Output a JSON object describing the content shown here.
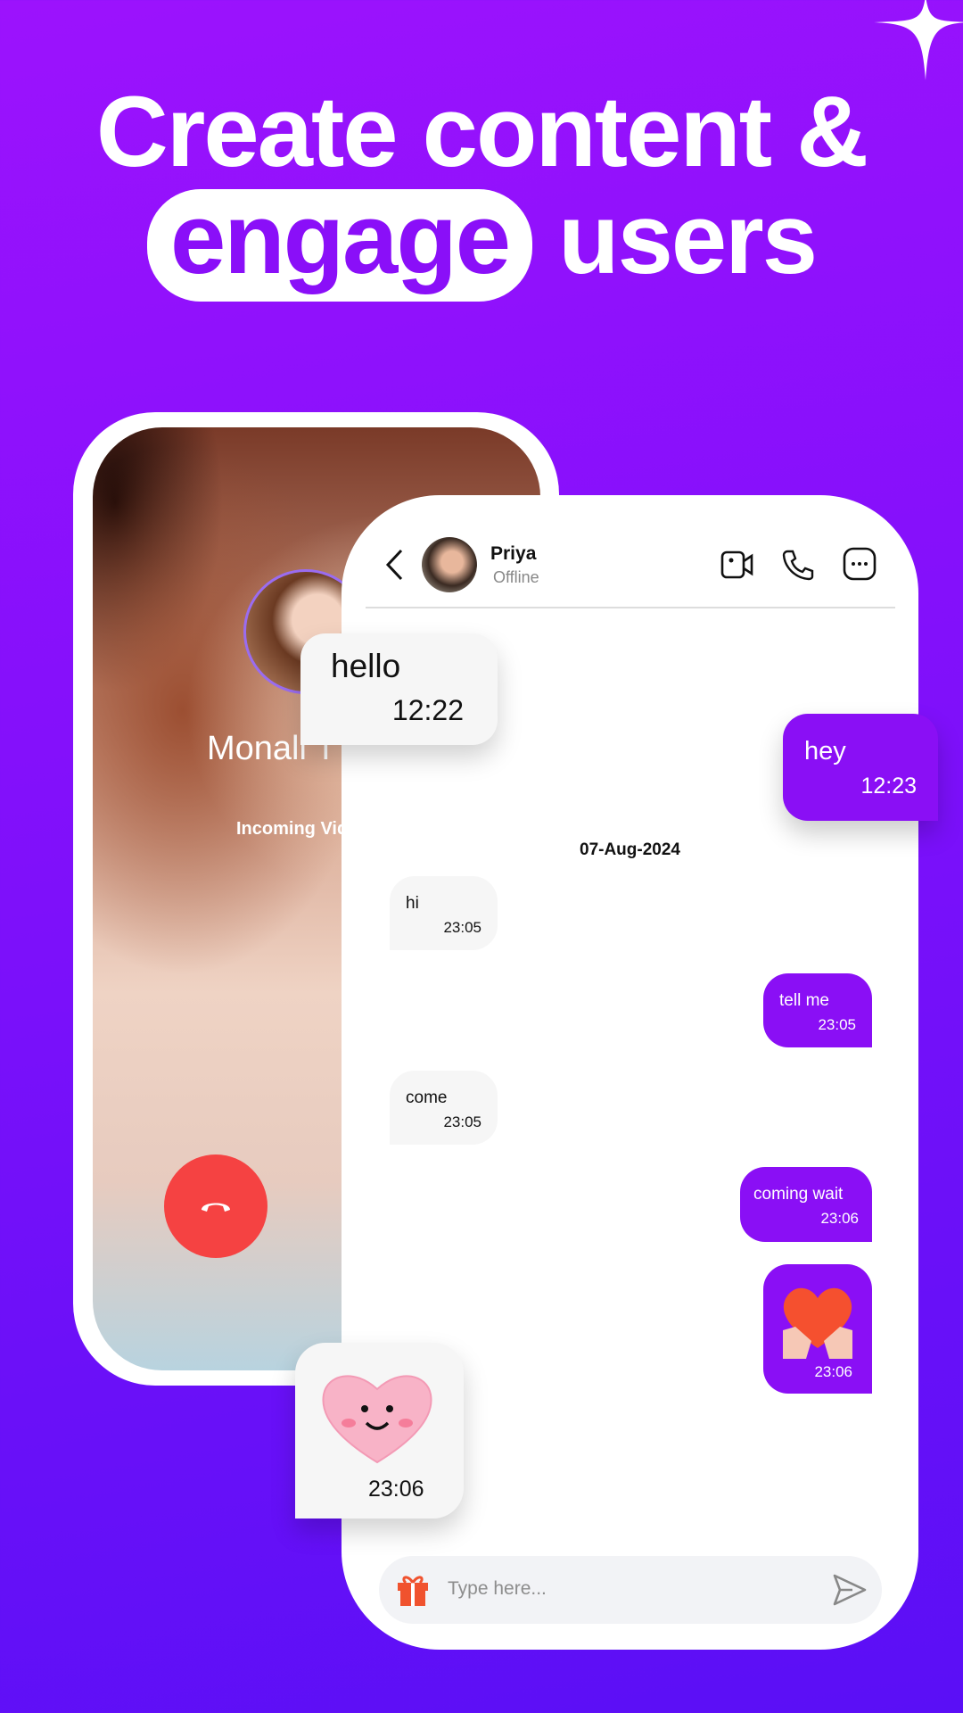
{
  "headline": {
    "line1": "Create content &",
    "highlight": "engage",
    "line2_rest": "users"
  },
  "call": {
    "caller_name": "Monali T",
    "status": "Incoming Vid"
  },
  "chat": {
    "contact_name": "Priya",
    "contact_status": "Offline",
    "date_separator": "07-Aug-2024",
    "messages": [
      {
        "text": "hello",
        "time": "12:22",
        "dir": "received"
      },
      {
        "text": "hey",
        "time": "12:23",
        "dir": "sent"
      },
      {
        "text": "hi",
        "time": "23:05",
        "dir": "received"
      },
      {
        "text": "tell me",
        "time": "23:05",
        "dir": "sent"
      },
      {
        "text": "come",
        "time": "23:05",
        "dir": "received"
      },
      {
        "text": "coming wait",
        "time": "23:06",
        "dir": "sent"
      },
      {
        "sticker": "heart-hands-sticker",
        "time": "23:06",
        "dir": "sent"
      },
      {
        "sticker": "smiling-heart-sticker",
        "time": "23:06",
        "dir": "received"
      }
    ],
    "input_placeholder": "Type here..."
  },
  "colors": {
    "accent": "#8a0ff5",
    "end_call": "#f54242",
    "bg_top": "#9c12fd",
    "bg_bottom": "#5a0ff6"
  }
}
